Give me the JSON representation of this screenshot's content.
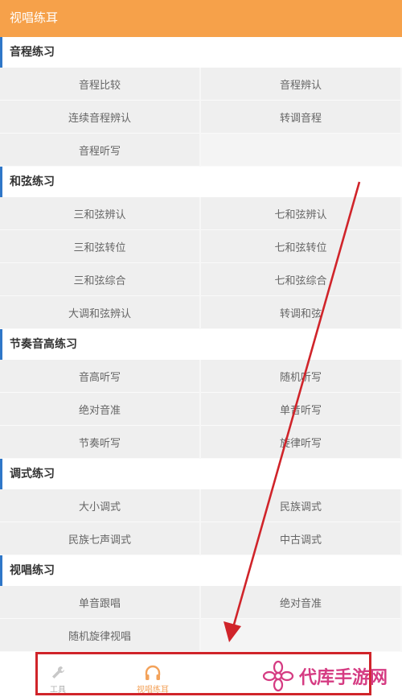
{
  "header": {
    "title": "视唱练耳"
  },
  "sections": [
    {
      "title": "音程练习",
      "items": [
        "音程比较",
        "音程辨认",
        "连续音程辨认",
        "转调音程",
        "音程听写",
        ""
      ]
    },
    {
      "title": "和弦练习",
      "items": [
        "三和弦辨认",
        "七和弦辨认",
        "三和弦转位",
        "七和弦转位",
        "三和弦综合",
        "七和弦综合",
        "大调和弦辨认",
        "转调和弦"
      ]
    },
    {
      "title": "节奏音高练习",
      "items": [
        "音高听写",
        "随机听写",
        "绝对音准",
        "单音听写",
        "节奏听写",
        "旋律听写"
      ]
    },
    {
      "title": "调式练习",
      "items": [
        "大小调式",
        "民族调式",
        "民族七声调式",
        "中古调式"
      ]
    },
    {
      "title": "视唱练习",
      "items": [
        "单音跟唱",
        "绝对音准",
        "随机旋律视唱",
        ""
      ]
    }
  ],
  "bottom_nav": {
    "tabs": [
      {
        "label": "工具",
        "icon": "wrench-icon",
        "active": false
      },
      {
        "label": "视唱练耳",
        "icon": "headphones-icon",
        "active": true
      }
    ]
  },
  "watermark": {
    "text": "代库手游网"
  },
  "colors": {
    "header": "#f6a14a",
    "accent": "#2f77c8",
    "annotation": "#d0242a",
    "watermark": "#d53b82"
  }
}
